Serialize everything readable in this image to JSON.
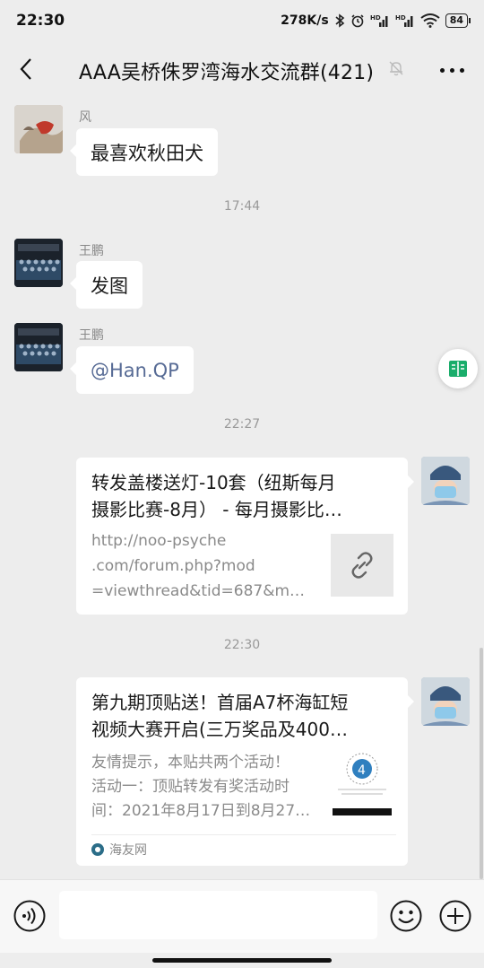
{
  "status_bar": {
    "time": "22:30",
    "net_speed": "278K/s",
    "battery": "84",
    "icons": [
      "bluetooth-icon",
      "alarm-icon",
      "signal-hd-icon",
      "signal-hd-icon",
      "wifi-icon",
      "battery-icon"
    ]
  },
  "header": {
    "title": "AAA吴桥侏罗湾海水交流群(421)",
    "back_icon": "back-arrow-icon",
    "mute_icon": "mute-bell-icon",
    "more_icon": "more-icon"
  },
  "messages": [
    {
      "sender": "风",
      "text": "最喜欢秋田犬"
    },
    {
      "timestamp": "17:44"
    },
    {
      "sender": "王鹏",
      "text": "发图"
    },
    {
      "sender": "王鹏",
      "text": "@Han.QP"
    },
    {
      "timestamp": "22:27"
    },
    {
      "self": true,
      "card_title_lines": [
        "转发盖楼送灯-10套（纽斯每月",
        "摄影比赛-8月） - 每月摄影比…"
      ],
      "card_desc_lines": [
        "http://noo-psyche",
        ".com/forum.php?mod",
        "=viewthread&tid=687&m…"
      ],
      "thumb_icon": "link-icon"
    },
    {
      "timestamp": "22:30"
    },
    {
      "self": true,
      "card_title_lines": [
        "第九期顶贴送！首届A7杯海缸短",
        "视频大赛开启(三万奖品及400…"
      ],
      "card_desc_lines": [
        "友情提示，本贴共两个活动！",
        "活动一：顶贴转发有奖活动时",
        "间：2021年8月17日到8月27…"
      ],
      "source": "海友网"
    }
  ],
  "input_bar": {
    "placeholder": "",
    "voice_icon": "voice-icon",
    "emoji_icon": "emoji-icon",
    "plus_icon": "plus-icon"
  }
}
